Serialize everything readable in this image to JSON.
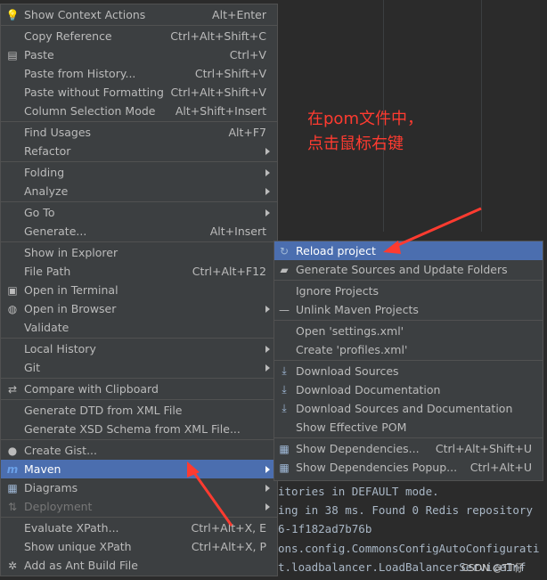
{
  "main_menu": [
    {
      "label": "Show Context Actions",
      "shortcut": "Alt+Enter",
      "icon": "bulb-icon"
    },
    {
      "sep": true
    },
    {
      "label": "Copy Reference",
      "shortcut": "Ctrl+Alt+Shift+C"
    },
    {
      "label": "Paste",
      "shortcut": "Ctrl+V",
      "icon": "clipboard-icon"
    },
    {
      "label": "Paste from History...",
      "shortcut": "Ctrl+Shift+V"
    },
    {
      "label": "Paste without Formatting",
      "shortcut": "Ctrl+Alt+Shift+V"
    },
    {
      "label": "Column Selection Mode",
      "shortcut": "Alt+Shift+Insert"
    },
    {
      "sep": true
    },
    {
      "label": "Find Usages",
      "shortcut": "Alt+F7"
    },
    {
      "label": "Refactor",
      "submenu": true
    },
    {
      "sep": true
    },
    {
      "label": "Folding",
      "submenu": true
    },
    {
      "label": "Analyze",
      "submenu": true
    },
    {
      "sep": true
    },
    {
      "label": "Go To",
      "submenu": true
    },
    {
      "label": "Generate...",
      "shortcut": "Alt+Insert"
    },
    {
      "sep": true
    },
    {
      "label": "Show in Explorer"
    },
    {
      "label": "File Path",
      "shortcut": "Ctrl+Alt+F12"
    },
    {
      "label": "Open in Terminal",
      "icon": "terminal-icon"
    },
    {
      "label": "Open in Browser",
      "icon": "globe-icon",
      "submenu": true
    },
    {
      "label": "Validate"
    },
    {
      "sep": true
    },
    {
      "label": "Local History",
      "submenu": true
    },
    {
      "label": "Git",
      "submenu": true
    },
    {
      "sep": true
    },
    {
      "label": "Compare with Clipboard",
      "icon": "compare-icon"
    },
    {
      "sep": true
    },
    {
      "label": "Generate DTD from XML File"
    },
    {
      "label": "Generate XSD Schema from XML File..."
    },
    {
      "sep": true
    },
    {
      "label": "Create Gist...",
      "icon": "github-icon"
    },
    {
      "label": "Maven",
      "icon": "maven-icon",
      "submenu": true,
      "selected": true
    },
    {
      "label": "Diagrams",
      "icon": "diagram-icon",
      "submenu": true
    },
    {
      "label": "Deployment",
      "icon": "deployment-icon",
      "submenu": true,
      "disabled": true
    },
    {
      "sep": true
    },
    {
      "label": "Evaluate XPath...",
      "shortcut": "Ctrl+Alt+X, E"
    },
    {
      "label": "Show unique XPath",
      "shortcut": "Ctrl+Alt+X, P"
    },
    {
      "label": "Add as Ant Build File",
      "icon": "ant-icon"
    }
  ],
  "maven_submenu": [
    {
      "label": "Reload project",
      "icon": "reload-icon",
      "selected": true
    },
    {
      "label": "Generate Sources and Update Folders",
      "icon": "folder-icon"
    },
    {
      "sep": true
    },
    {
      "label": "Ignore Projects"
    },
    {
      "label": "Unlink Maven Projects",
      "icon": "minus-icon"
    },
    {
      "sep": true
    },
    {
      "label": "Open 'settings.xml'"
    },
    {
      "label": "Create 'profiles.xml'"
    },
    {
      "sep": true
    },
    {
      "label": "Download Sources",
      "icon": "download-icon"
    },
    {
      "label": "Download Documentation",
      "icon": "download-icon"
    },
    {
      "label": "Download Sources and Documentation",
      "icon": "download-icon"
    },
    {
      "label": "Show Effective POM"
    },
    {
      "sep": true
    },
    {
      "label": "Show Dependencies...",
      "shortcut": "Ctrl+Alt+Shift+U",
      "icon": "dependencies-icon"
    },
    {
      "label": "Show Dependencies Popup...",
      "shortcut": "Ctrl+Alt+U",
      "icon": "dependencies-icon"
    }
  ],
  "annotation": [
    "在pom文件中，",
    "点击鼠标右键"
  ],
  "console_lines": [
    "itories in DEFAULT mode.",
    "ing in 38 ms. Found 0 Redis repository",
    "6-1f182ad7b76b",
    "ons.config.CommonsConfigAutoConfigurati",
    "t.loadbalancer.LoadBalancerServiceInf"
  ],
  "watermark": "CSDN @TT仔",
  "colors": {
    "menu_bg": "#3c3f41",
    "selected": "#4b6eaf",
    "annotation": "#ff3b30"
  }
}
